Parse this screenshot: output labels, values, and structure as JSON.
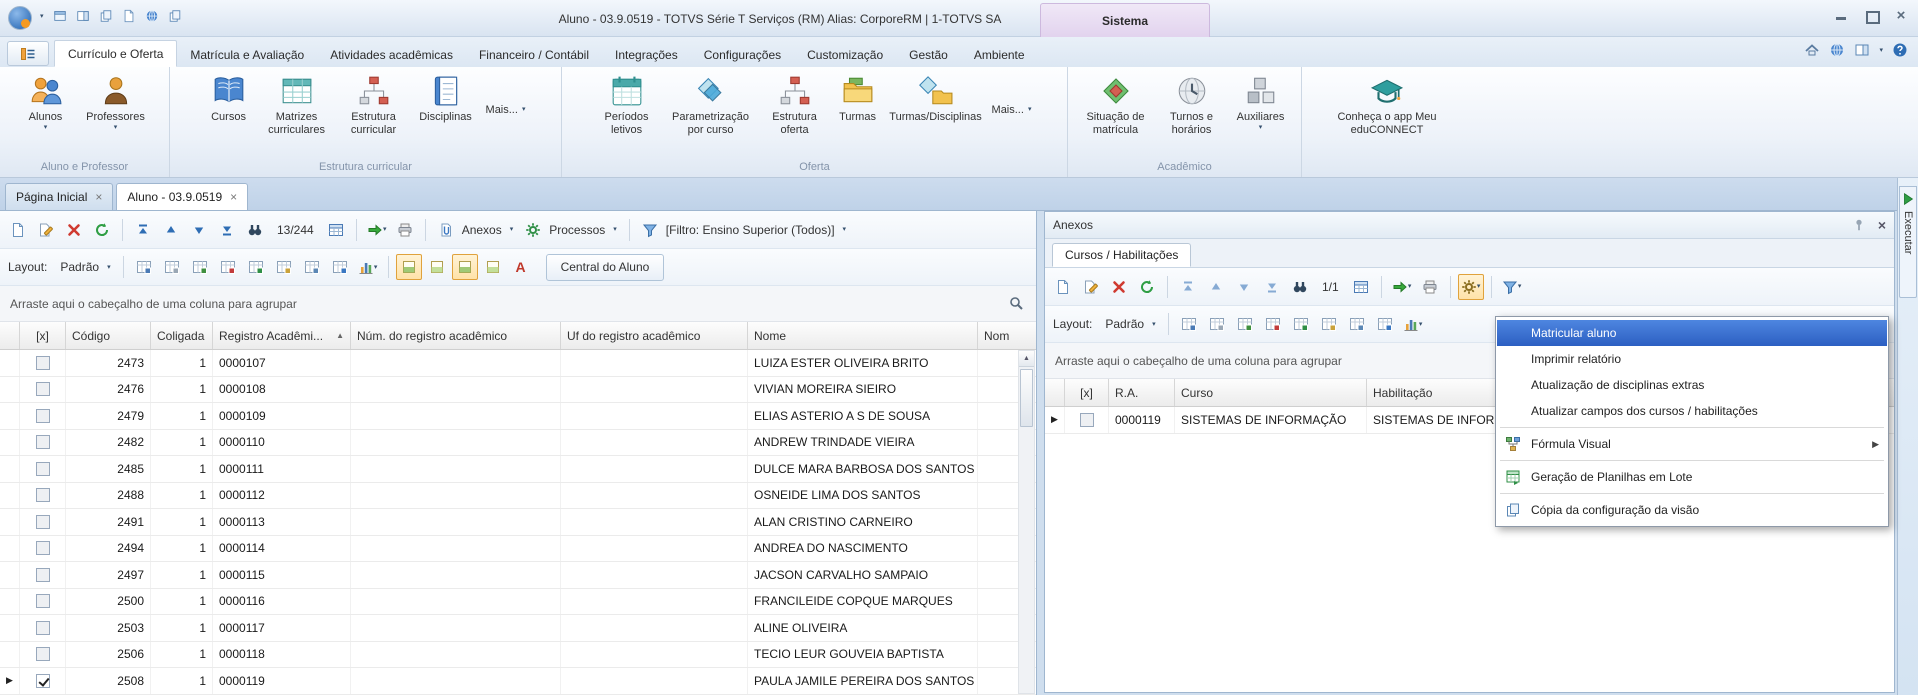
{
  "titlebar": {
    "title": "Aluno - 03.9.0519 - TOTVS Série T Serviços (RM) Alias: CorporeRM | 1-TOTVS SA",
    "context_tab_group": "Sistema",
    "quick_access_icons": [
      "dropdown",
      "new-window",
      "panel-window",
      "copy-pages",
      "page",
      "globe",
      "copy"
    ],
    "window_controls": [
      "minimize",
      "restore",
      "close"
    ]
  },
  "ribbon": {
    "tabs": [
      {
        "label": "Currículo e Oferta",
        "active": true
      },
      {
        "label": "Matrícula e Avaliação"
      },
      {
        "label": "Atividades acadêmicas"
      },
      {
        "label": "Financeiro / Contábil"
      },
      {
        "label": "Integrações"
      },
      {
        "label": "Configurações"
      },
      {
        "label": "Customização"
      },
      {
        "label": "Gestão"
      },
      {
        "label": "Ambiente"
      }
    ],
    "right_icons": [
      "collapse-ribbon",
      "help-globe",
      "layout-panels",
      "dropdown",
      "help"
    ],
    "groups": [
      {
        "label": "Aluno e Professor",
        "buttons": [
          {
            "label": "Alunos",
            "dropdown": true,
            "icon": "students"
          },
          {
            "label": "Professores",
            "dropdown": true,
            "icon": "teacher"
          }
        ]
      },
      {
        "label": "Estrutura curricular",
        "buttons": [
          {
            "label": "Cursos",
            "icon": "book"
          },
          {
            "label": "Matrizes curriculares",
            "icon": "matrix"
          },
          {
            "label": "Estrutura curricular",
            "icon": "structure"
          },
          {
            "label": "Disciplinas",
            "icon": "notebook"
          },
          {
            "label": "Mais...",
            "dropdown": true
          }
        ]
      },
      {
        "label": "Oferta",
        "buttons": [
          {
            "label": "Períodos letivos",
            "icon": "calendar"
          },
          {
            "label": "Parametrização por curso",
            "icon": "kite"
          },
          {
            "label": "Estrutura oferta",
            "icon": "structure"
          },
          {
            "label": "Turmas",
            "icon": "folder"
          },
          {
            "label": "Turmas/Disciplinas",
            "icon": "kite-folder"
          },
          {
            "label": "Mais...",
            "dropdown": true
          }
        ]
      },
      {
        "label": "Acadêmico",
        "buttons": [
          {
            "label": "Situação de matrícula",
            "icon": "diamond"
          },
          {
            "label": "Turnos e horários",
            "icon": "clock"
          },
          {
            "label": "Auxiliares",
            "dropdown": true,
            "icon": "cubes"
          }
        ]
      },
      {
        "label": "",
        "buttons": [
          {
            "label": "Conheça o app Meu eduCONNECT",
            "icon": "graduation-cap"
          }
        ]
      }
    ]
  },
  "document_tabs": [
    {
      "label": "Página Inicial",
      "active": false
    },
    {
      "label": "Aluno - 03.9.0519",
      "active": true
    }
  ],
  "left_panel": {
    "toolbar": {
      "record_counter": "13/244",
      "anexos_label": "Anexos",
      "processos_label": "Processos",
      "filter_label": "[Filtro: Ensino Superior (Todos)]",
      "icons": [
        "new",
        "edit",
        "delete",
        "refresh",
        "first",
        "previous",
        "next",
        "last",
        "search",
        "grid-view",
        "execute",
        "print",
        "attachments",
        "processes",
        "filter"
      ]
    },
    "layout_bar": {
      "label": "Layout:",
      "value": "Padrão",
      "central_button": "Central do Aluno",
      "icons": [
        "save-layout",
        "layout-gray",
        "grid-add",
        "grid-export",
        "grid-excel",
        "grid-remove",
        "grid-sum",
        "grid-gold",
        "chart",
        "pos-1",
        "pos-2",
        "pos-3",
        "pos-4",
        "font-color"
      ]
    },
    "groupby_text": "Arraste aqui o cabeçalho de uma coluna para agrupar",
    "grid": {
      "columns": [
        "[x]",
        "Código",
        "Coligada",
        "Registro Acadêmi...",
        "Núm. do registro acadêmico",
        "Uf do registro acadêmico",
        "Nome",
        "Nom"
      ],
      "sorted_column": "Registro Acadêmi...",
      "sort_direction": "asc",
      "rows": [
        {
          "codigo": "2473",
          "coligada": "1",
          "registro": "0000107",
          "nome": "LUIZA ESTER OLIVEIRA BRITO",
          "checked": false
        },
        {
          "codigo": "2476",
          "coligada": "1",
          "registro": "0000108",
          "nome": "VIVIAN MOREIRA SIEIRO",
          "checked": false
        },
        {
          "codigo": "2479",
          "coligada": "1",
          "registro": "0000109",
          "nome": "ELIAS ASTERIO A S DE SOUSA",
          "checked": false
        },
        {
          "codigo": "2482",
          "coligada": "1",
          "registro": "0000110",
          "nome": "ANDREW TRINDADE VIEIRA",
          "checked": false
        },
        {
          "codigo": "2485",
          "coligada": "1",
          "registro": "0000111",
          "nome": "DULCE MARA BARBOSA DOS SANTOS",
          "checked": false
        },
        {
          "codigo": "2488",
          "coligada": "1",
          "registro": "0000112",
          "nome": "OSNEIDE LIMA DOS SANTOS",
          "checked": false
        },
        {
          "codigo": "2491",
          "coligada": "1",
          "registro": "0000113",
          "nome": "ALAN CRISTINO CARNEIRO",
          "checked": false
        },
        {
          "codigo": "2494",
          "coligada": "1",
          "registro": "0000114",
          "nome": "ANDREA DO NASCIMENTO",
          "checked": false
        },
        {
          "codigo": "2497",
          "coligada": "1",
          "registro": "0000115",
          "nome": "JACSON CARVALHO SAMPAIO",
          "checked": false
        },
        {
          "codigo": "2500",
          "coligada": "1",
          "registro": "0000116",
          "nome": "FRANCILEIDE COPQUE MARQUES",
          "checked": false
        },
        {
          "codigo": "2503",
          "coligada": "1",
          "registro": "0000117",
          "nome": "ALINE OLIVEIRA",
          "checked": false
        },
        {
          "codigo": "2506",
          "coligada": "1",
          "registro": "0000118",
          "nome": "TECIO LEUR GOUVEIA BAPTISTA",
          "checked": false
        },
        {
          "codigo": "2508",
          "coligada": "1",
          "registro": "0000119",
          "nome": "PAULA JAMILE PEREIRA DOS SANTOS",
          "checked": true
        }
      ]
    }
  },
  "right_panel": {
    "title": "Anexos",
    "tab_label": "Cursos / Habilitações",
    "toolbar": {
      "record_counter": "1/1",
      "icons": [
        "new",
        "edit",
        "delete",
        "refresh",
        "first",
        "previous",
        "next",
        "last",
        "search",
        "grid-view",
        "execute",
        "print",
        "processes",
        "filter"
      ]
    },
    "layout_bar": {
      "label": "Layout:",
      "value": "Padrão"
    },
    "groupby_text": "Arraste aqui o cabeçalho de uma coluna para agrupar",
    "grid": {
      "columns": [
        "[x]",
        "R.A.",
        "Curso",
        "Habilitação"
      ],
      "rows": [
        {
          "ra": "0000119",
          "curso": "SISTEMAS DE INFORMAÇÃO",
          "habilitacao": "SISTEMAS DE INFORMAÇÃO",
          "checked": false
        }
      ]
    }
  },
  "context_menu": {
    "items": [
      {
        "label": "Matricular aluno",
        "highlighted": true
      },
      {
        "label": "Imprimir relatório"
      },
      {
        "label": "Atualização de disciplinas extras"
      },
      {
        "label": "Atualizar campos dos cursos / habilitações"
      },
      {
        "label": "Fórmula Visual",
        "icon": "visual-formula-icon",
        "has_submenu": true
      },
      {
        "label": "Geração de Planilhas em Lote",
        "icon": "batch-spreadsheet-icon"
      },
      {
        "label": "Cópia da configuração da visão",
        "icon": "copy-view-icon"
      }
    ]
  },
  "side_strip": {
    "label": "Executar"
  },
  "colors": {
    "menu_highlight": "#2c5fc2",
    "pressed_button_bg": "#ffe2a8",
    "pressed_button_border": "#e0a23c",
    "panel_border": "#9fb6cf",
    "context_group_bg": "#e2d3ee"
  }
}
